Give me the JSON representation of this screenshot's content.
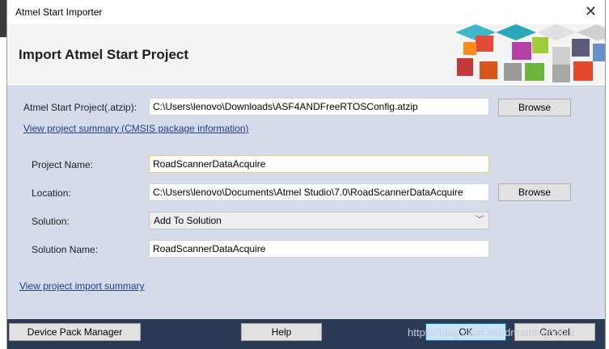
{
  "window": {
    "title": "Atmel Start Importer"
  },
  "header": {
    "title": "Import Atmel Start Project"
  },
  "form": {
    "atzip_label": "Atmel Start Project(.atzip):",
    "atzip_value": "C:\\Users\\lenovo\\Downloads\\ASF4ANDFreeRTOSConfig.atzip",
    "browse_label": "Browse",
    "summary_link": "View project summary (CMSIS package information)",
    "project_name_label": "Project Name:",
    "project_name_value": "RoadScannerDataAcquire",
    "location_label": "Location:",
    "location_value": "C:\\Users\\lenovo\\Documents\\Atmel Studio\\7.0\\RoadScannerDataAcquire",
    "browse2_label": "Browse",
    "solution_label": "Solution:",
    "solution_value": "Add To Solution",
    "solution_name_label": "Solution Name:",
    "solution_name_value": "RoadScannerDataAcquire",
    "import_summary_link": "View project import summary"
  },
  "footer": {
    "device_pack_label": "Device Pack Manager",
    "help_label": "Help",
    "ok_label": "OK",
    "cancel_label": "Cancel",
    "watermark": "https://blog.csdn.net/dreamhighqhui"
  },
  "colors": {
    "accent": "#2b3a55",
    "link": "#1e3d8f",
    "panel": "#d6dbe9"
  }
}
